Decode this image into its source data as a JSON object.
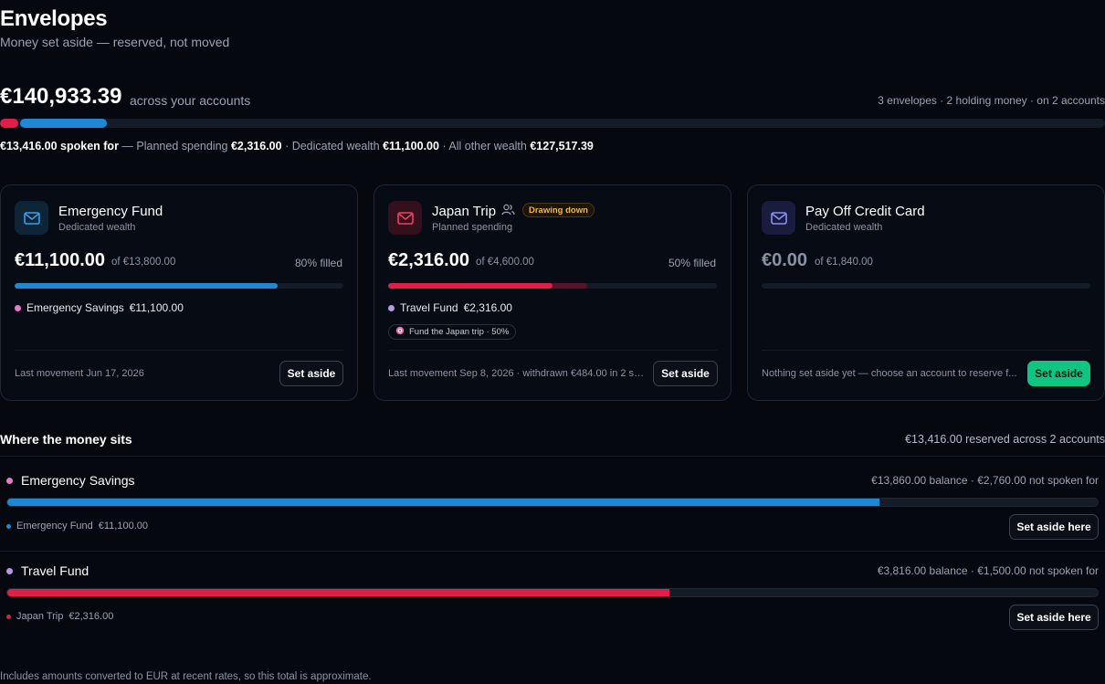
{
  "header": {
    "title": "Envelopes",
    "subtitle": "Money set aside — reserved, not moved"
  },
  "summary": {
    "total": "€140,933.39",
    "total_suffix": "across your accounts",
    "meta": "3 envelopes · 2 holding money · on 2 accounts",
    "spoken_amount": "€13,416.00 spoken for",
    "planned_label": "— Planned spending",
    "planned_amount": "€2,316.00",
    "dedicated_label": "· Dedicated wealth",
    "dedicated_amount": "€11,100.00",
    "other_label": "· All other wealth",
    "other_amount": "€127,517.39",
    "planned_fraction": 0.0164,
    "dedicated_fraction": 0.0788
  },
  "envelopes": [
    {
      "name": "Emergency Fund",
      "type": "Dedicated wealth",
      "amount": "€11,100.00",
      "of": "of €13,800.00",
      "pct": "80% filled",
      "fill_fraction": 0.8,
      "fill_color": "#1e88d4",
      "source_name": "Emergency Savings",
      "source_amount": "€11,100.00",
      "source_color": "#e879c9",
      "footer": "Last movement Jun 17, 2026",
      "button": "Set aside"
    },
    {
      "name": "Japan Trip",
      "type": "Planned spending",
      "badge": "Drawing down",
      "amount": "€2,316.00",
      "of": "of €4,600.00",
      "pct": "50% filled",
      "fill_fraction": 0.5,
      "fill_color": "#e11d48",
      "source_name": "Travel Fund",
      "source_amount": "€2,316.00",
      "source_color": "#b896e8",
      "goal": "Fund the Japan trip · 50%",
      "footer": "Last movement Sep 8, 2026 · withdrawn €484.00 in 2 sp...",
      "button": "Set aside"
    },
    {
      "name": "Pay Off Credit Card",
      "type": "Dedicated wealth",
      "amount": "€0.00",
      "of": "of €1,840.00",
      "fill_fraction": 0,
      "footer": "Nothing set aside yet — choose an account to reserve f...",
      "button": "Set aside"
    }
  ],
  "where": {
    "title": "Where the money sits",
    "meta": "€13,416.00 reserved across 2 accounts",
    "accounts": [
      {
        "name": "Emergency Savings",
        "dot_color": "#e879c9",
        "meta": "€13,860.00 balance · €2,760.00 not spoken for",
        "fill_fraction": 0.8,
        "fill_color": "#1e88d4",
        "envelope_name": "Emergency Fund",
        "envelope_amount": "€11,100.00",
        "button": "Set aside here"
      },
      {
        "name": "Travel Fund",
        "dot_color": "#b896e8",
        "meta": "€3,816.00 balance · €1,500.00 not spoken for",
        "fill_fraction": 0.607,
        "fill_color": "#e11d48",
        "envelope_name": "Japan Trip",
        "envelope_amount": "€2,316.00",
        "button": "Set aside here"
      }
    ]
  },
  "footnote": "Includes amounts converted to EUR at recent rates, so this total is approximate."
}
